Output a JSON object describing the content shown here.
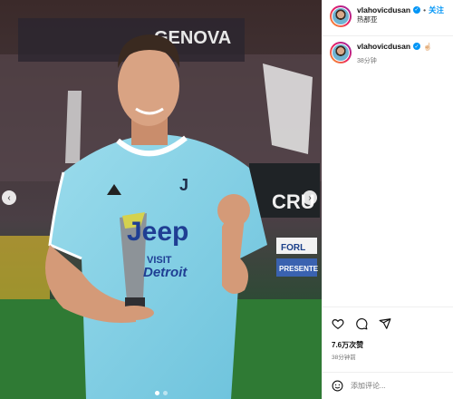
{
  "post": {
    "username": "vlahovicdusan",
    "separator": "•",
    "follow_label": "关注",
    "location": "热那亚",
    "caption_text": "☝🏻",
    "caption_time": "38分钟",
    "likes": "7.6万次赞",
    "time_ago": "38分钟前",
    "comment_placeholder": "添加评论..."
  },
  "media": {
    "banner_text": "GENOVA",
    "board_text": "CRU",
    "sign_text_1": "FORL",
    "sign_text_2": "PRESENTE",
    "shirt_text_1": "Jeep",
    "shirt_text_2": "VISIT",
    "shirt_text_3": "Detroit"
  },
  "icons": {
    "like": "heart-icon",
    "comment": "comment-icon",
    "share": "share-icon",
    "emoji": "emoji-icon",
    "prev": "chevron-left-icon",
    "next": "chevron-right-icon"
  },
  "colors": {
    "accent": "#0095f6",
    "jersey": "#8fd3e8"
  }
}
